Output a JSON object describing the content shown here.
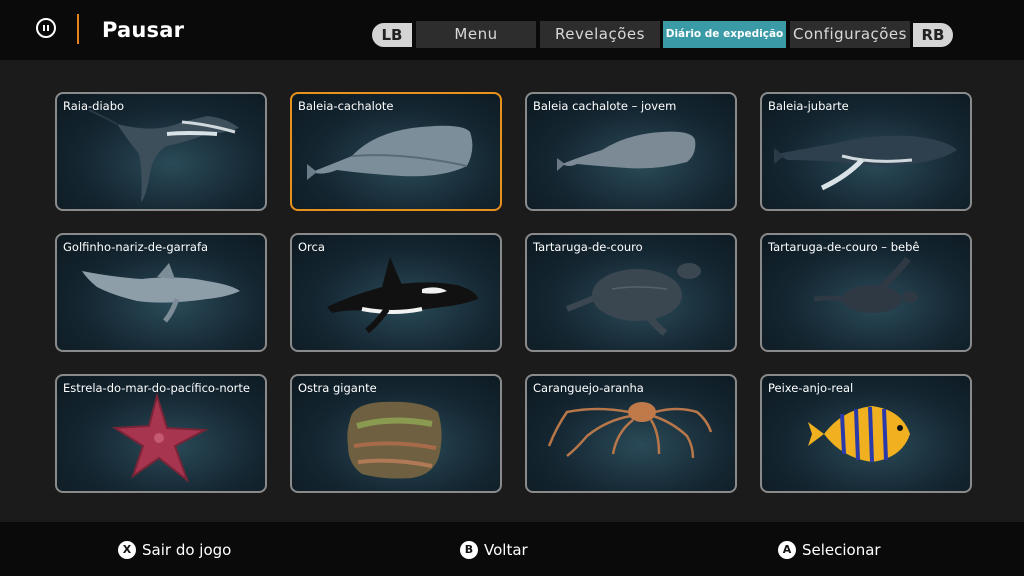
{
  "header": {
    "title": "Pausar",
    "lb_label": "LB",
    "rb_label": "RB",
    "tabs": [
      {
        "label": "Menu",
        "active": false
      },
      {
        "label": "Revelações",
        "active": false
      },
      {
        "label": "Diário de expedição",
        "active": true
      },
      {
        "label": "Configurações",
        "active": false
      }
    ]
  },
  "grid": {
    "selected_index": 1,
    "cards": [
      {
        "label": "Raia-diabo",
        "icon": "manta-ray-icon"
      },
      {
        "label": "Baleia-cachalote",
        "icon": "sperm-whale-icon"
      },
      {
        "label": "Baleia cachalote – jovem",
        "icon": "young-sperm-whale-icon"
      },
      {
        "label": "Baleia-jubarte",
        "icon": "humpback-whale-icon"
      },
      {
        "label": "Golfinho-nariz-de-garrafa",
        "icon": "dolphin-icon"
      },
      {
        "label": "Orca",
        "icon": "orca-icon"
      },
      {
        "label": "Tartaruga-de-couro",
        "icon": "leatherback-turtle-icon"
      },
      {
        "label": "Tartaruga-de-couro – bebê",
        "icon": "baby-turtle-icon"
      },
      {
        "label": "Estrela-do-mar-do-pacífico-norte",
        "icon": "starfish-icon"
      },
      {
        "label": "Ostra gigante",
        "icon": "giant-oyster-icon"
      },
      {
        "label": "Caranguejo-aranha",
        "icon": "spider-crab-icon"
      },
      {
        "label": "Peixe-anjo-real",
        "icon": "angelfish-icon"
      }
    ]
  },
  "footer": {
    "exit": {
      "glyph": "X",
      "label": "Sair do jogo"
    },
    "back": {
      "glyph": "B",
      "label": "Voltar"
    },
    "select": {
      "glyph": "A",
      "label": "Selecionar"
    }
  },
  "colors": {
    "accent_orange": "#e8921e",
    "active_tab": "#3a9aa6",
    "card_border": "#8a8a8a"
  }
}
